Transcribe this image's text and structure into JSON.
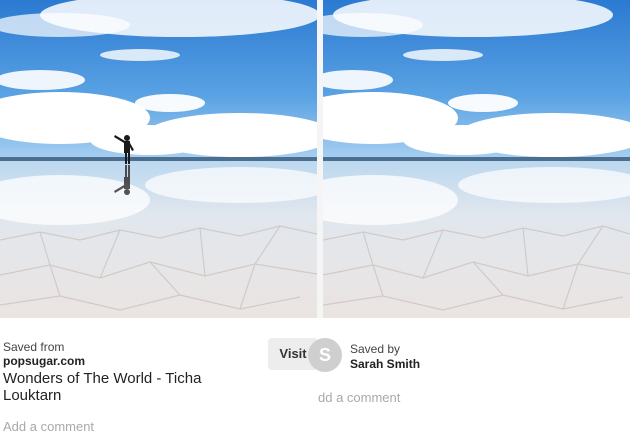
{
  "left_pin": {
    "image_alt": "person standing on reflective salt flat under blue sky",
    "saved_from_label": "Saved from",
    "source": "popsugar.com",
    "title": "Wonders of The World - Ticha Louktarn",
    "comment_placeholder": "Add a comment"
  },
  "visit_button": {
    "label": "Visit"
  },
  "right_pin": {
    "image_alt": "reflective salt flat under blue sky",
    "avatar_letter": "S",
    "saved_by_label": "Saved by",
    "saved_by_name": "Sarah Smith",
    "comment_placeholder": "dd a comment"
  },
  "colors": {
    "sky_top": "#2f7fd4",
    "sky_bottom": "#9ec9ef",
    "cloud": "#ffffff",
    "salt": "#e9e5e3",
    "button_bg": "#ededed",
    "placeholder": "#a9a9a9"
  }
}
